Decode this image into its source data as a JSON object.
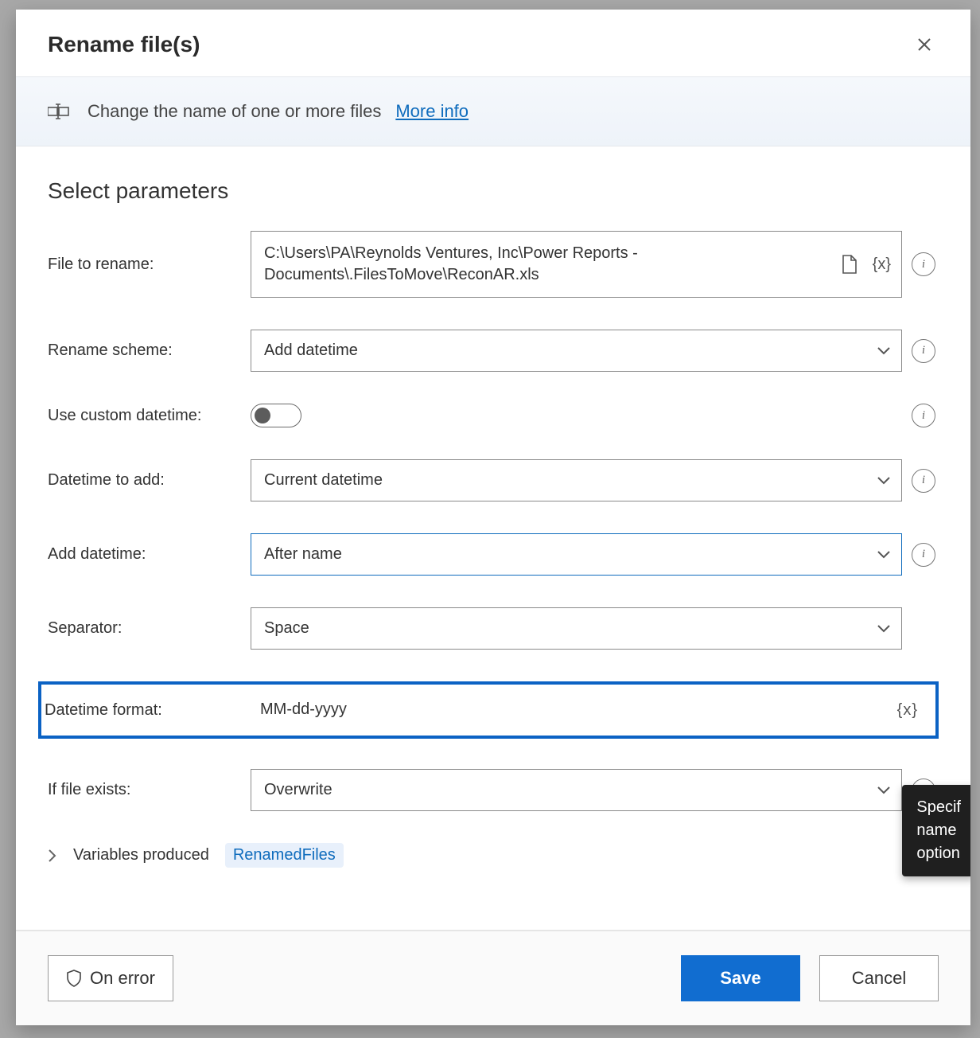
{
  "dialog": {
    "title": "Rename file(s)",
    "info_text": "Change the name of one or more files",
    "more_info": "More info",
    "section_title": "Select parameters"
  },
  "fields": {
    "file_to_rename": {
      "label": "File to rename:",
      "value": "C:\\Users\\PA\\Reynolds Ventures, Inc\\Power Reports - Documents\\.FilesToMove\\ReconAR.xls"
    },
    "rename_scheme": {
      "label": "Rename scheme:",
      "value": "Add datetime"
    },
    "use_custom_datetime": {
      "label": "Use custom datetime:",
      "value": false
    },
    "datetime_to_add": {
      "label": "Datetime to add:",
      "value": "Current datetime"
    },
    "add_datetime": {
      "label": "Add datetime:",
      "value": "After name"
    },
    "separator": {
      "label": "Separator:",
      "value": "Space"
    },
    "datetime_format": {
      "label": "Datetime format:",
      "value": "MM-dd-yyyy"
    },
    "if_file_exists": {
      "label": "If file exists:",
      "value": "Overwrite"
    }
  },
  "variables": {
    "label": "Variables produced",
    "name": "RenamedFiles"
  },
  "footer": {
    "on_error": "On error",
    "save": "Save",
    "cancel": "Cancel"
  },
  "tooltip": {
    "line1": "Specif",
    "line2": "name",
    "line3": "option"
  },
  "icons": {
    "file_select": "file-icon",
    "variable": "{x}",
    "info": "i"
  }
}
